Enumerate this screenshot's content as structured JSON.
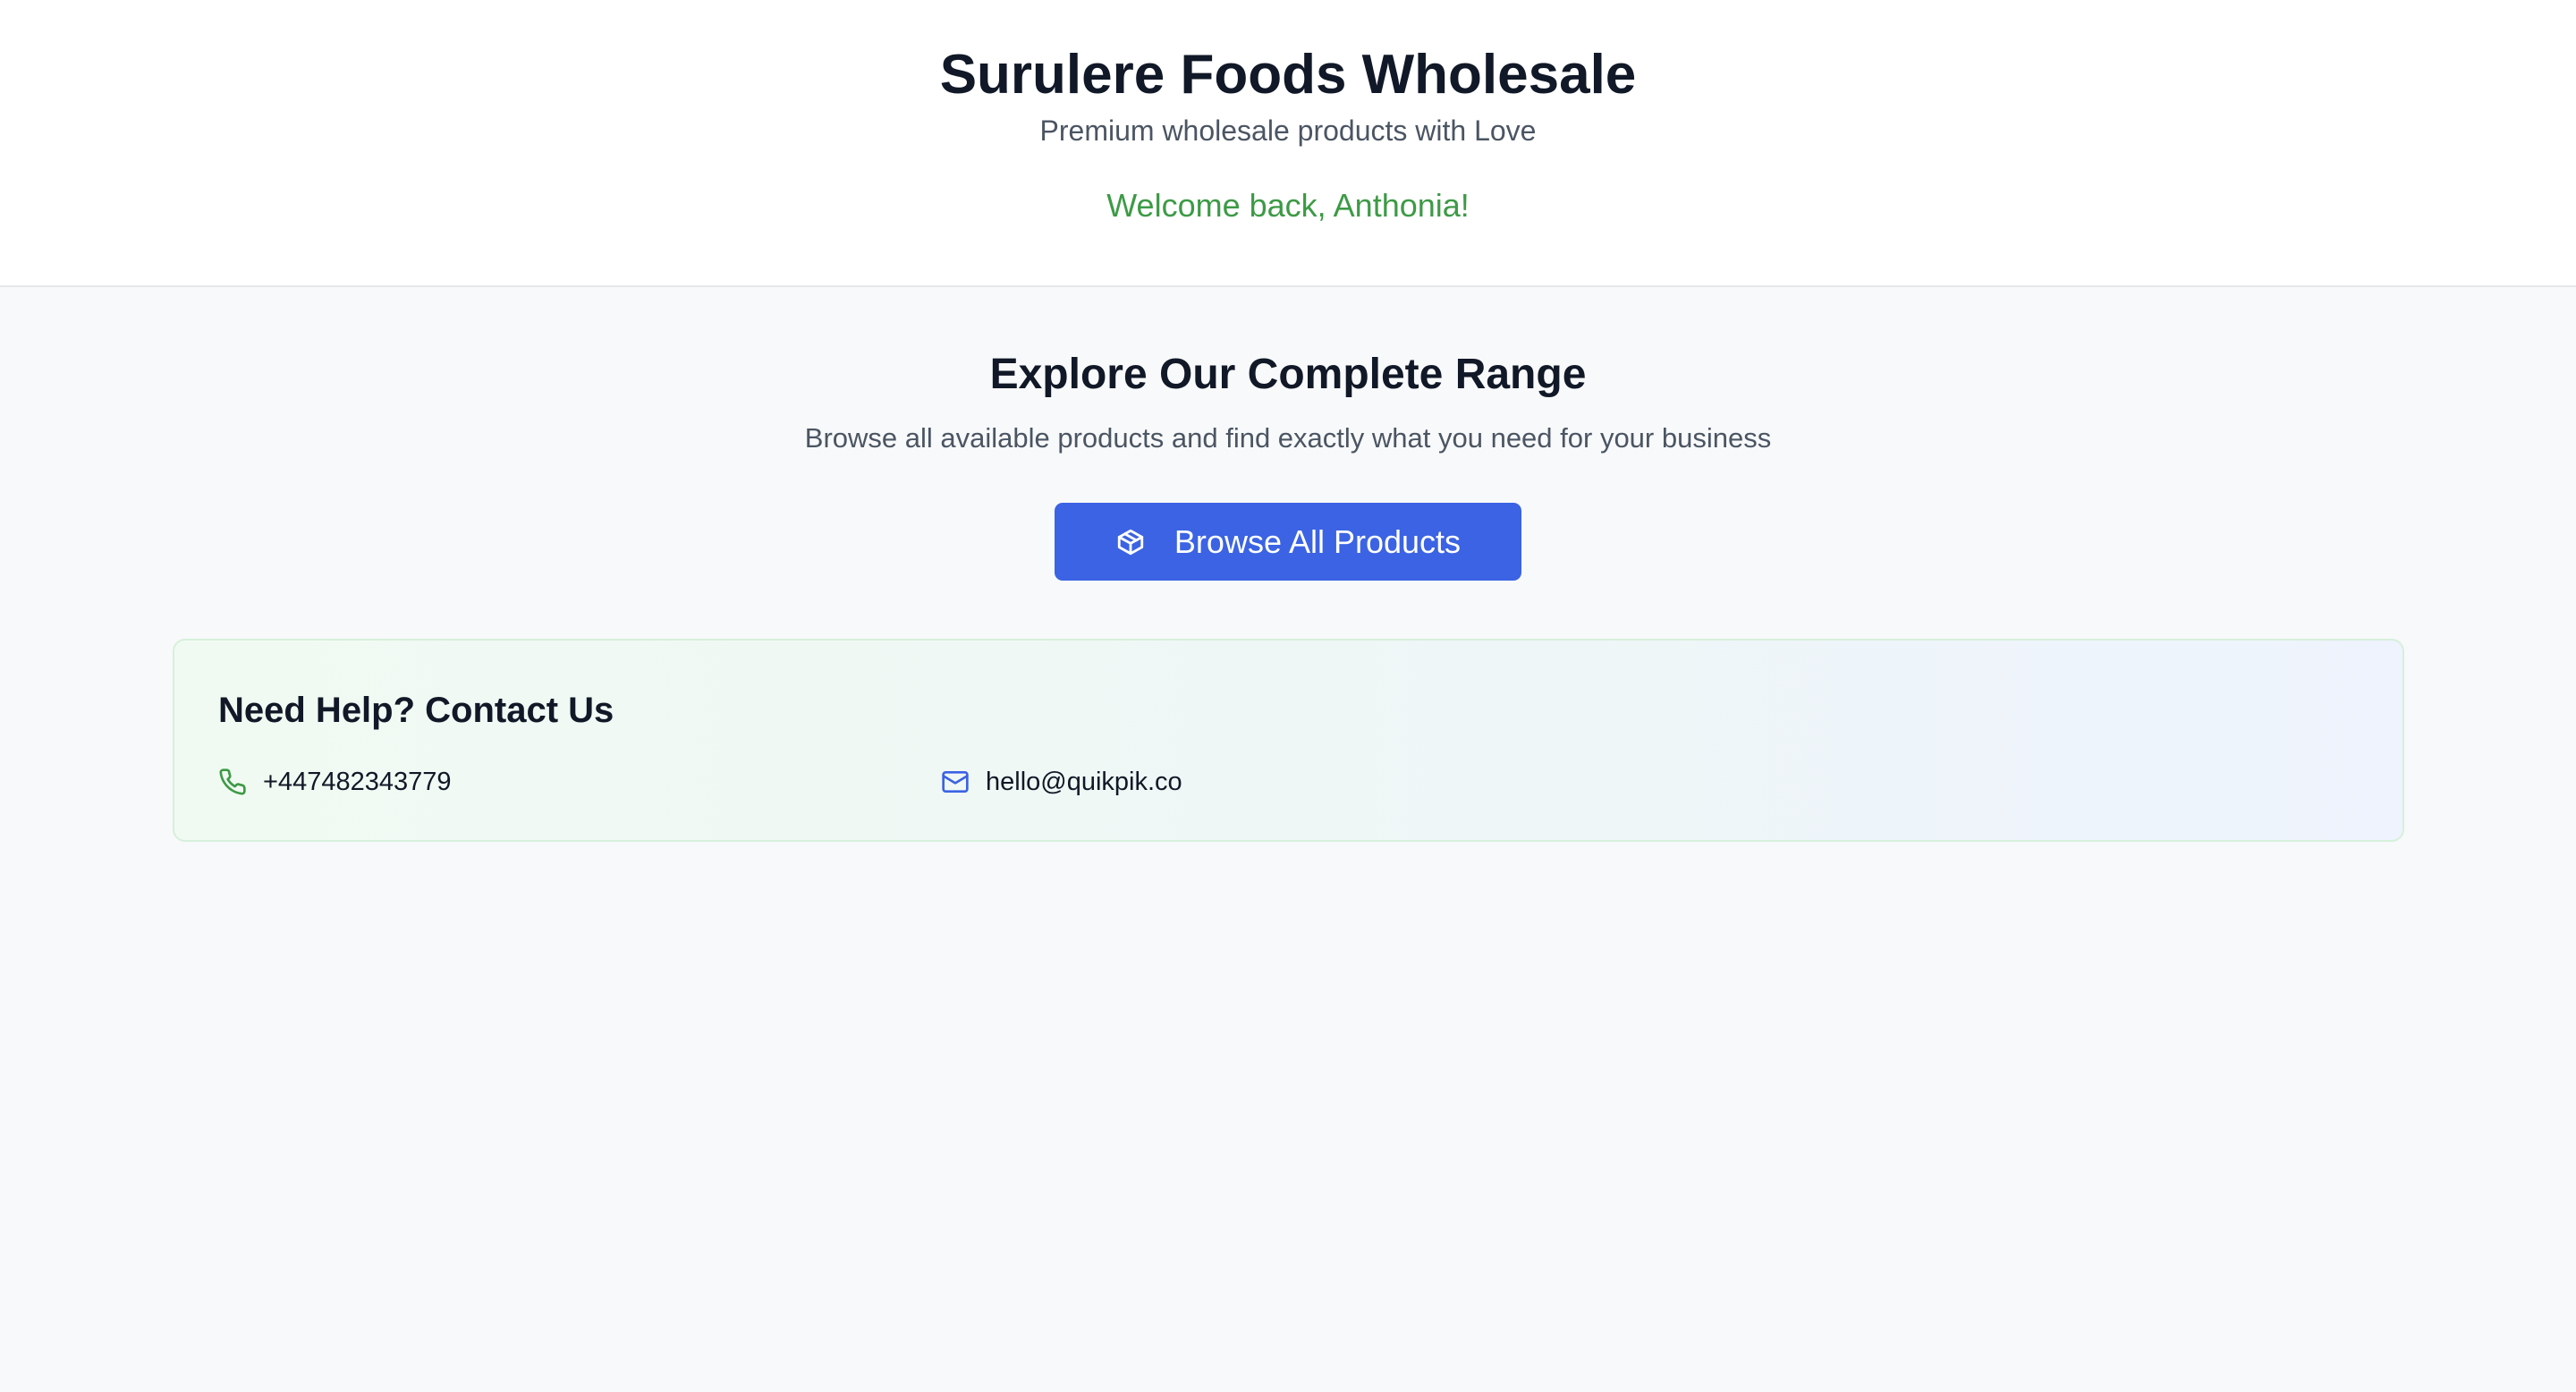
{
  "header": {
    "title": "Surulere Foods Wholesale",
    "tagline": "Premium wholesale products with Love",
    "welcome": "Welcome back, Anthonia!"
  },
  "main": {
    "title": "Explore Our Complete Range",
    "subtitle": "Browse all available products and find exactly what you need for your business",
    "browse_button": {
      "label": "Browse All Products",
      "icon": "package-icon"
    }
  },
  "contact": {
    "title": "Need Help? Contact Us",
    "phone": {
      "icon": "phone-icon",
      "value": "+447482343779"
    },
    "email": {
      "icon": "mail-icon",
      "value": "hello@quikpik.co"
    }
  },
  "colors": {
    "primary": "#3b63e3",
    "welcome_green": "#3d9a46",
    "heading": "#111827",
    "muted": "#4b5563",
    "page_bg": "#f8f9fa"
  }
}
